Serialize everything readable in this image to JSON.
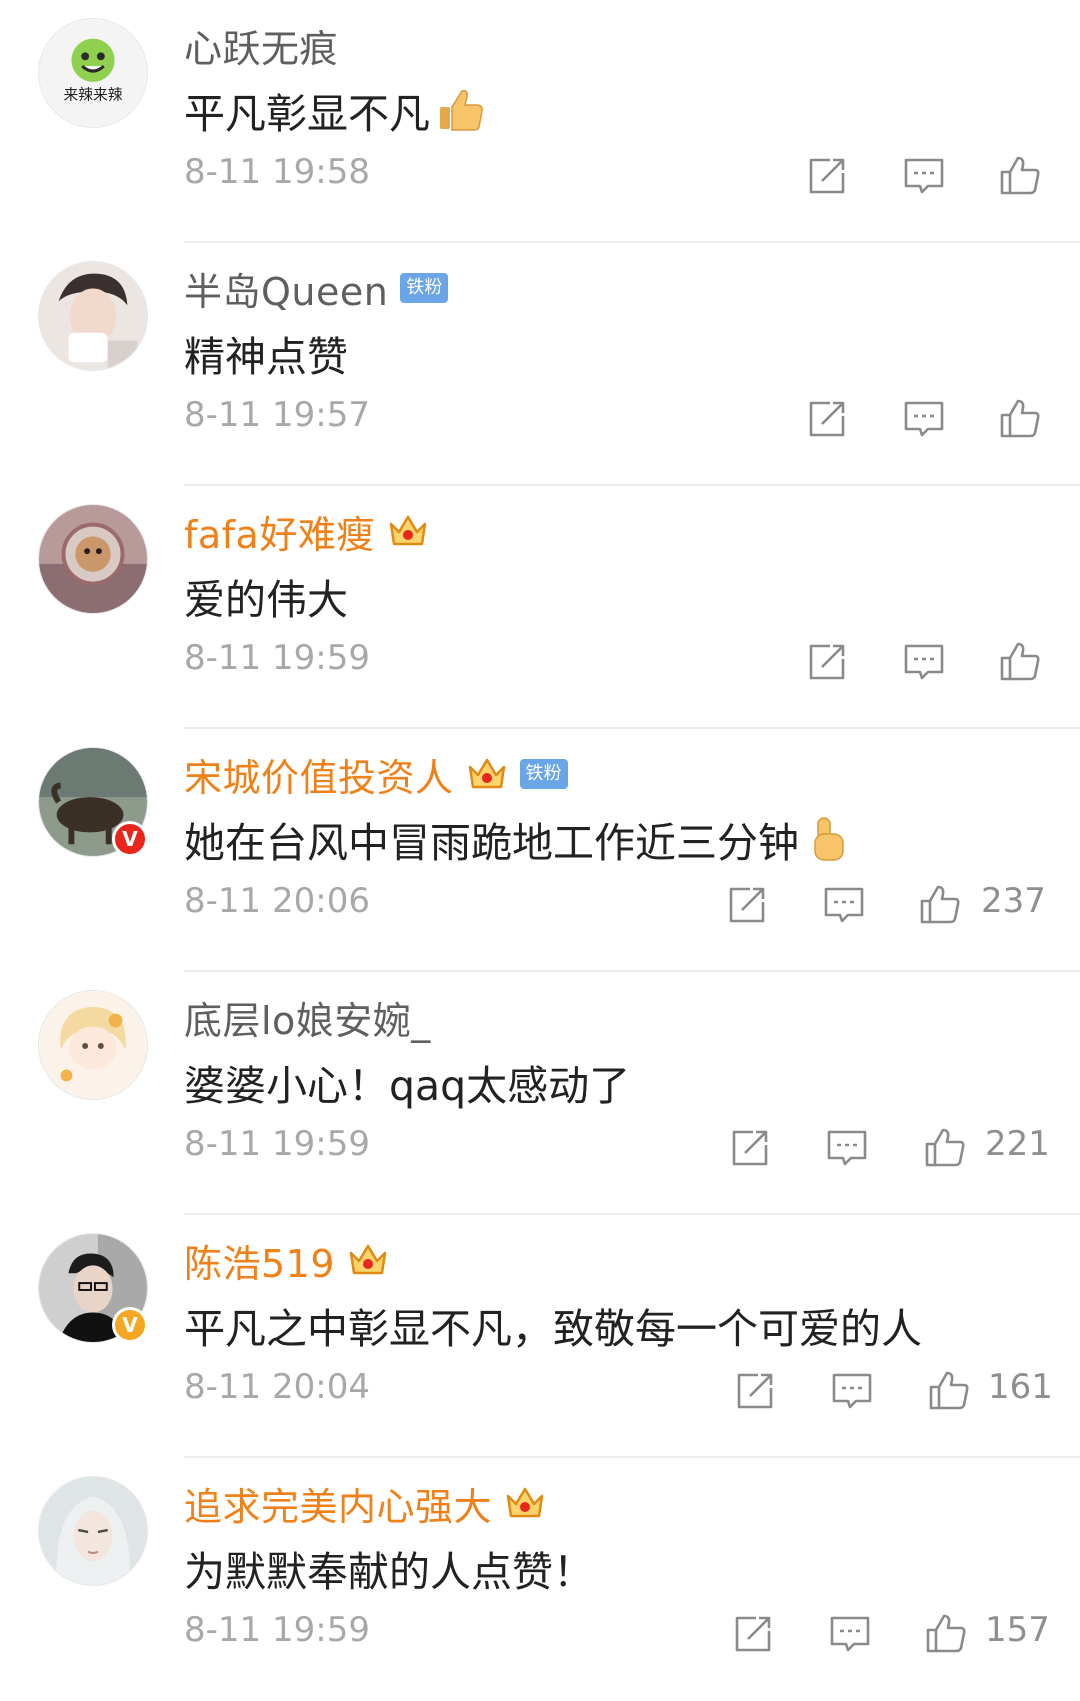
{
  "comments": [
    {
      "name": "心跃无痕",
      "vip": false,
      "tiefen": false,
      "badge": "",
      "text": "平凡彰显不凡",
      "emoji": true,
      "time": "8-11 19:58",
      "likes": ""
    },
    {
      "name": "半岛Queen",
      "vip": false,
      "tiefen": true,
      "badge": "",
      "text": "精神点赞",
      "emoji": false,
      "time": "8-11 19:57",
      "likes": ""
    },
    {
      "name": "fafa好难瘦",
      "vip": true,
      "tiefen": false,
      "badge": "",
      "text": "爱的伟大",
      "emoji": false,
      "time": "8-11 19:59",
      "likes": ""
    },
    {
      "name": "宋城价值投资人",
      "vip": true,
      "tiefen": true,
      "badge": "red",
      "text": "她在台风中冒雨跪地工作近三分钟",
      "emoji": true,
      "time": "8-11 20:06",
      "likes": "237"
    },
    {
      "name": "底层lo娘安婉_",
      "vip": false,
      "tiefen": false,
      "badge": "",
      "text": "婆婆小心！qaq太感动了",
      "emoji": false,
      "time": "8-11 19:59",
      "likes": "221"
    },
    {
      "name": "陈浩519",
      "vip": true,
      "tiefen": false,
      "badge": "gold",
      "text": "平凡之中彰显不凡，致敬每一个可爱的人",
      "emoji": false,
      "time": "8-11 20:04",
      "likes": "161"
    },
    {
      "name": "追求完美内心强大",
      "vip": true,
      "tiefen": false,
      "badge": "",
      "text": "为默默奉献的人点赞！",
      "emoji": false,
      "time": "8-11 19:59",
      "likes": "157"
    }
  ],
  "labels": {
    "tiefen": "铁粉",
    "verified": "V",
    "avatar_0_text": "来辣来辣"
  },
  "icons": {
    "repost": "repost-icon",
    "comment": "comment-icon",
    "like": "thumbs-up-icon",
    "crown": "vip-crown-icon",
    "emoji": "thumbs-up-emoji"
  },
  "colors": {
    "vip_name": "#f08018",
    "normal_name": "#5f5f5f",
    "comment_text": "#222222",
    "meta": "#a8a8a8",
    "tiefen_badge": "#6aa5e8",
    "verified_red": "#e8261b",
    "verified_gold": "#f5a623"
  }
}
